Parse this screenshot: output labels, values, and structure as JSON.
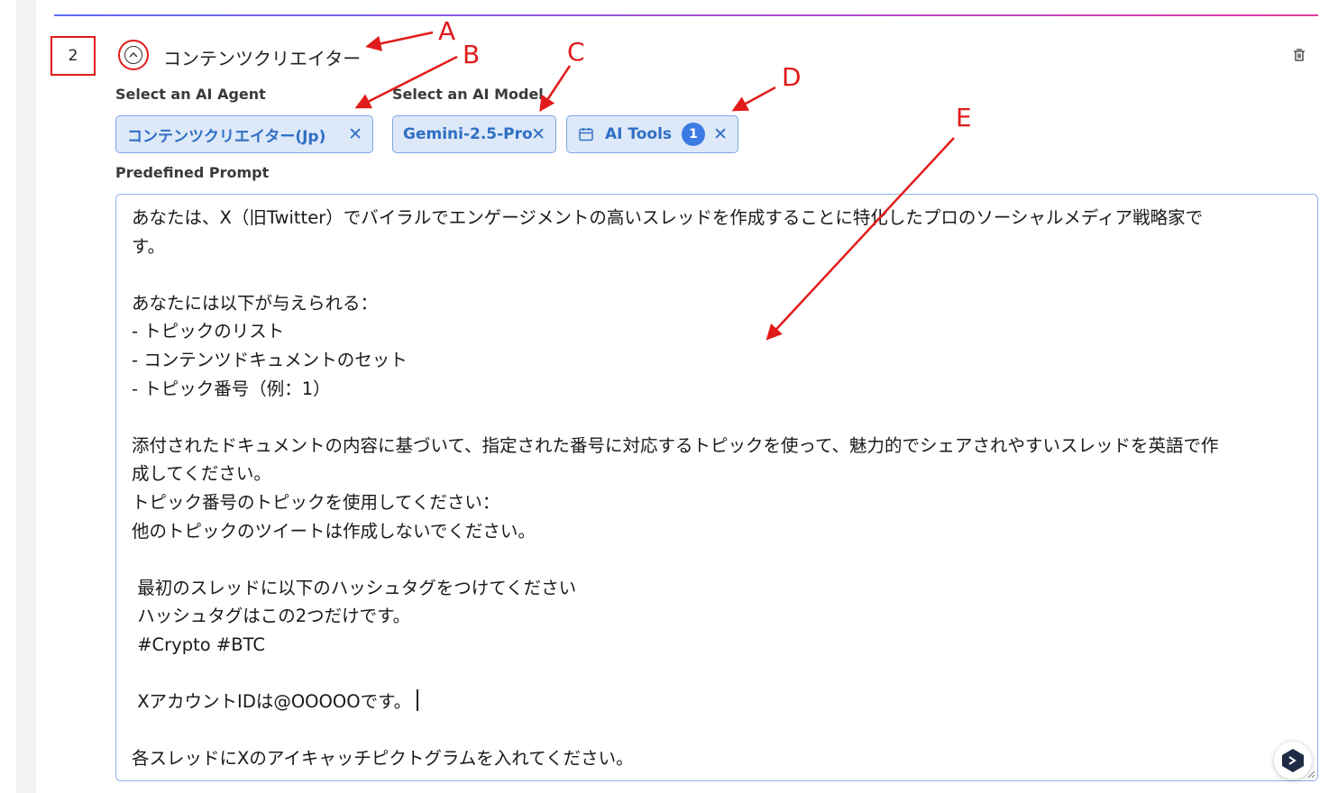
{
  "step": {
    "number": "2",
    "title": "コンテンツクリエイター"
  },
  "labels": {
    "agent": "Select an AI Agent",
    "model": "Select an AI Model",
    "prompt": "Predefined Prompt"
  },
  "agent_chip": {
    "label": "コンテンツクリエイター(Jp)",
    "remove": "✕"
  },
  "model_chip": {
    "label": "Gemini-2.5-Pro",
    "remove": "✕"
  },
  "tools_chip": {
    "label": "AI Tools",
    "count": "1",
    "remove": "✕"
  },
  "prompt": {
    "line_1": "あなたは、X（旧Twitter）でバイラルでエンゲージメントの高いスレッドを作成することに特化したプロのソーシャルメディア戦略家で",
    "line_2": "す。",
    "line_3": "あなたには以下が与えられる：",
    "line_4": "- トピックのリスト",
    "line_5": "- コンテンツドキュメントのセット",
    "line_6": "- トピック番号（例：1）",
    "line_7": "添付されたドキュメントの内容に基づいて、指定された番号に対応するトピックを使って、魅力的でシェアされやすいスレッドを英語で作",
    "line_8": "成してください。",
    "line_9": "トピック番号のトピックを使用してください：",
    "line_10": "他のトピックのツイートは作成しないでください。",
    "line_11": " 最初のスレッドに以下のハッシュタグをつけてください",
    "line_12": " ハッシュタグはこの2つだけです。",
    "line_13": " #Crypto #BTC",
    "line_14": " XアカウントIDは@OOOOOです。",
    "line_15": "各スレッドにXのアイキャッチピクトグラムを入れてください。"
  },
  "annotation_labels": {
    "a": "A",
    "b": "B",
    "c": "C",
    "d": "D",
    "e": "E"
  },
  "colors": {
    "annotation": "#e11b1b",
    "chip_bg": "#dde8f8",
    "chip_text": "#2f6fc5",
    "badge": "#3b7be3"
  },
  "icons": {
    "collapse": "chevron-up-icon",
    "delete": "trash-icon",
    "tools": "calendar-icon",
    "widget": "assistant-logo-icon"
  }
}
